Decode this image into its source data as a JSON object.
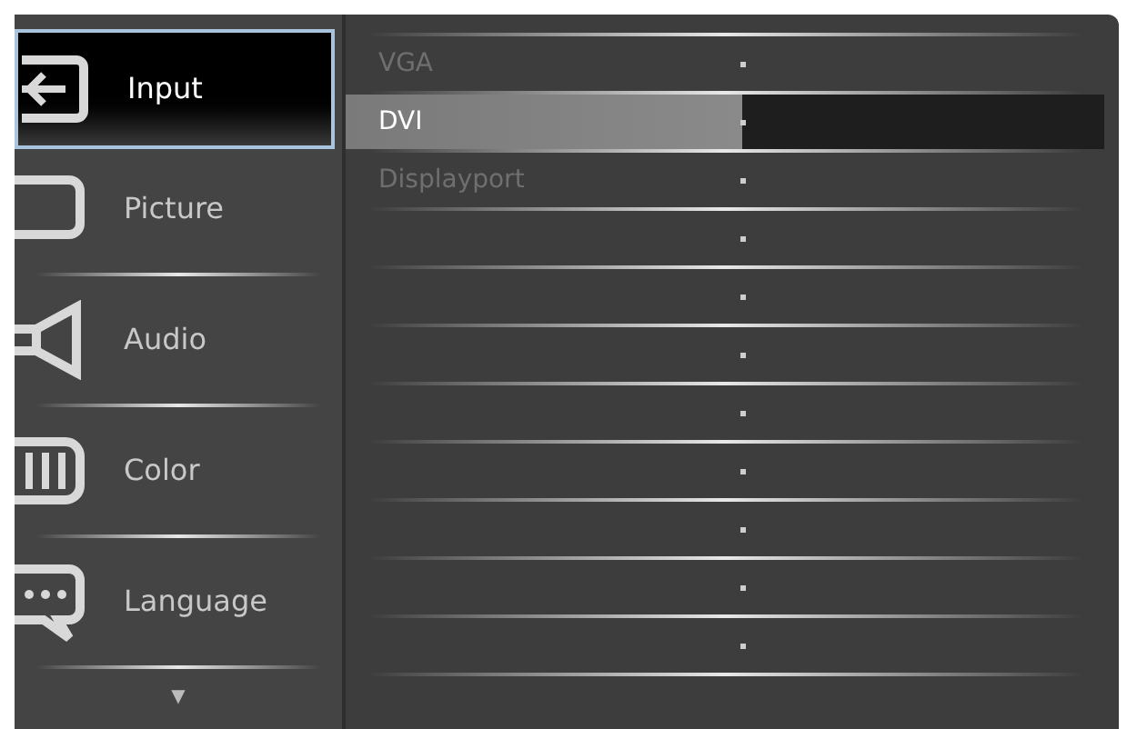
{
  "menu": [
    {
      "label": "Input",
      "kind": "input",
      "selected": true
    },
    {
      "label": "Picture",
      "kind": "picture",
      "selected": false
    },
    {
      "label": "Audio",
      "kind": "audio",
      "selected": false
    },
    {
      "label": "Color",
      "kind": "color",
      "selected": false
    },
    {
      "label": "Language",
      "kind": "language",
      "selected": false
    }
  ],
  "more_indicator": "▼",
  "options": [
    {
      "label": "VGA",
      "selected": false,
      "disabled": true
    },
    {
      "label": "DVI",
      "selected": true,
      "disabled": false
    },
    {
      "label": "Displayport",
      "selected": false,
      "disabled": true
    }
  ]
}
